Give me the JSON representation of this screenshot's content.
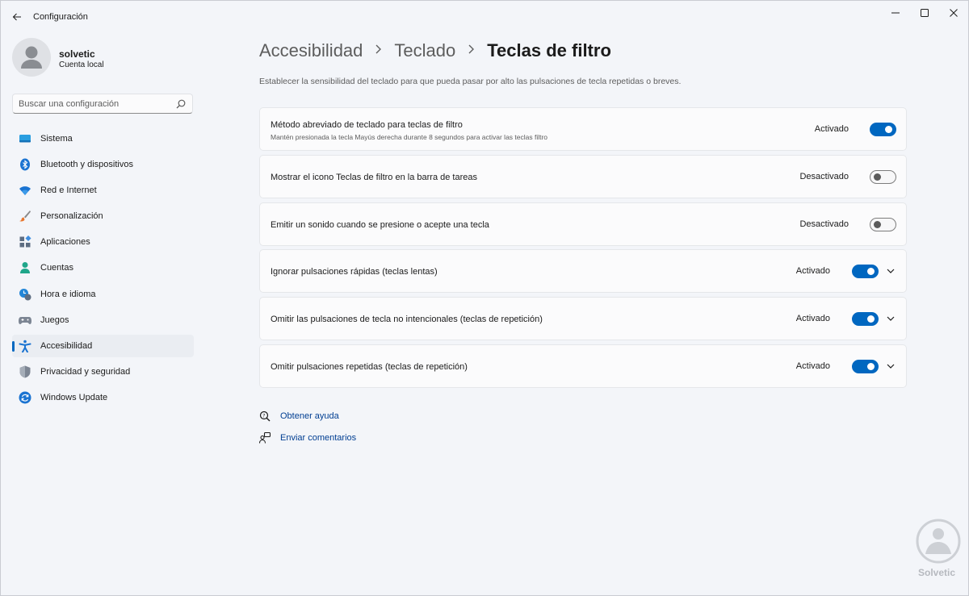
{
  "window": {
    "title": "Configuración"
  },
  "profile": {
    "name": "solvetic",
    "account_type": "Cuenta local"
  },
  "search": {
    "placeholder": "Buscar una configuración"
  },
  "sidebar": {
    "items": [
      {
        "label": "Sistema",
        "icon": "system-icon",
        "active": false
      },
      {
        "label": "Bluetooth y dispositivos",
        "icon": "bluetooth-icon",
        "active": false
      },
      {
        "label": "Red e Internet",
        "icon": "wifi-icon",
        "active": false
      },
      {
        "label": "Personalización",
        "icon": "brush-icon",
        "active": false
      },
      {
        "label": "Aplicaciones",
        "icon": "apps-icon",
        "active": false
      },
      {
        "label": "Cuentas",
        "icon": "person-icon",
        "active": false
      },
      {
        "label": "Hora e idioma",
        "icon": "clock-globe-icon",
        "active": false
      },
      {
        "label": "Juegos",
        "icon": "gamepad-icon",
        "active": false
      },
      {
        "label": "Accesibilidad",
        "icon": "accessibility-icon",
        "active": true
      },
      {
        "label": "Privacidad y seguridad",
        "icon": "shield-icon",
        "active": false
      },
      {
        "label": "Windows Update",
        "icon": "update-icon",
        "active": false
      }
    ]
  },
  "breadcrumb": {
    "level1": "Accesibilidad",
    "level2": "Teclado",
    "current": "Teclas de filtro"
  },
  "description": "Establecer la sensibilidad del teclado para que pueda pasar por alto las pulsaciones de tecla repetidas o breves.",
  "settings": [
    {
      "title": "Método abreviado de teclado para teclas de filtro",
      "subtitle": "Mantén presionada la tecla Mayús derecha durante 8 segundos para activar las teclas filtro",
      "state_label": "Activado",
      "on": true,
      "expandable": false
    },
    {
      "title": "Mostrar el icono Teclas de filtro en la barra de tareas",
      "subtitle": "",
      "state_label": "Desactivado",
      "on": false,
      "expandable": false
    },
    {
      "title": "Emitir un sonido cuando se presione o acepte una tecla",
      "subtitle": "",
      "state_label": "Desactivado",
      "on": false,
      "expandable": false
    },
    {
      "title": "Ignorar pulsaciones rápidas (teclas lentas)",
      "subtitle": "",
      "state_label": "Activado",
      "on": true,
      "expandable": true
    },
    {
      "title": "Omitir las pulsaciones de tecla no intencionales (teclas de repetición)",
      "subtitle": "",
      "state_label": "Activado",
      "on": true,
      "expandable": true
    },
    {
      "title": "Omitir pulsaciones repetidas (teclas de repetición)",
      "subtitle": "",
      "state_label": "Activado",
      "on": true,
      "expandable": true
    }
  ],
  "links": {
    "help": "Obtener ayuda",
    "feedback": "Enviar comentarios"
  },
  "watermark": {
    "text": "Solvetic"
  },
  "colors": {
    "accent": "#0067c0",
    "link": "#003e92",
    "window_bg": "#f3f5f9",
    "card_bg": "#fbfbfc"
  }
}
